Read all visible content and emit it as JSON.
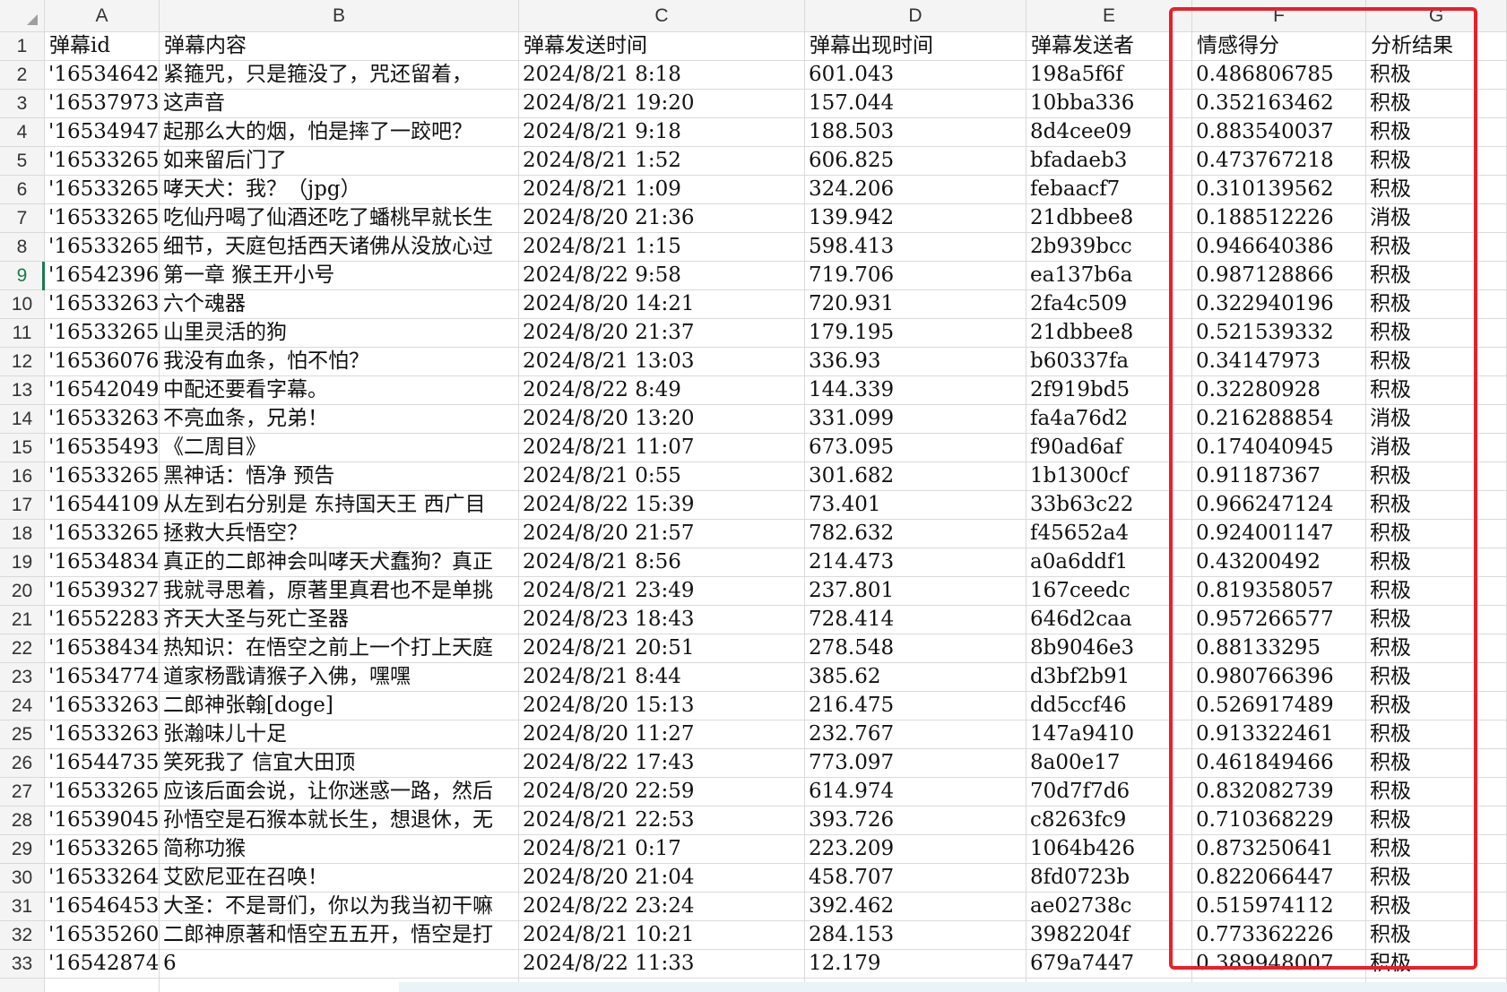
{
  "columns": [
    "A",
    "B",
    "C",
    "D",
    "E",
    "F",
    "G"
  ],
  "headers": [
    "弹幕id",
    "弹幕内容",
    "弹幕发送时间",
    "弹幕出现时间",
    "弹幕发送者",
    "情感得分",
    "分析结果"
  ],
  "active_row": 9,
  "highlight_color": "#e8202a",
  "rows": [
    [
      "'16534642",
      "紧箍咒，只是箍没了，咒还留着，",
      "2024/8/21  8:18",
      "601.043",
      "198a5f6f",
      "0.486806785",
      "积极"
    ],
    [
      "'16537973",
      "这声音",
      "2024/8/21  19:20",
      "157.044",
      "10bba336",
      "0.352163462",
      "积极"
    ],
    [
      "'16534947",
      "起那么大的烟，怕是摔了一跤吧？",
      "2024/8/21  9:18",
      "188.503",
      "8d4cee09",
      "0.883540037",
      "积极"
    ],
    [
      "'16533265",
      "如来留后门了",
      "2024/8/21  1:52",
      "606.825",
      "bfadaeb3",
      "0.473767218",
      "积极"
    ],
    [
      "'16533265",
      "哮天犬：我？（jpg）",
      "2024/8/21  1:09",
      "324.206",
      "febaacf7",
      "0.310139562",
      "积极"
    ],
    [
      "'16533265",
      "吃仙丹喝了仙酒还吃了蟠桃早就长生",
      "2024/8/20  21:36",
      "139.942",
      "21dbbee8",
      "0.188512226",
      "消极"
    ],
    [
      "'16533265",
      "细节，天庭包括西天诸佛从没放心过",
      "2024/8/21  1:15",
      "598.413",
      "2b939bcc",
      "0.946640386",
      "积极"
    ],
    [
      "'16542396",
      "第一章  猴王开小号",
      "2024/8/22  9:58",
      "719.706",
      "ea137b6a",
      "0.987128866",
      "积极"
    ],
    [
      "'16533263",
      "六个魂器",
      "2024/8/20  14:21",
      "720.931",
      "2fa4c509",
      "0.322940196",
      "积极"
    ],
    [
      "'16533265",
      "山里灵活的狗",
      "2024/8/20  21:37",
      "179.195",
      "21dbbee8",
      "0.521539332",
      "积极"
    ],
    [
      "'16536076",
      "我没有血条，怕不怕？",
      "2024/8/21  13:03",
      "336.93",
      "b60337fa",
      "0.34147973",
      "积极"
    ],
    [
      "'16542049",
      "中配还要看字幕。",
      "2024/8/22  8:49",
      "144.339",
      "2f919bd5",
      "0.32280928",
      "积极"
    ],
    [
      "'16533263",
      "不亮血条，兄弟！",
      "2024/8/20  13:20",
      "331.099",
      "fa4a76d2",
      "0.216288854",
      "消极"
    ],
    [
      "'16535493",
      "《二周目》",
      "2024/8/21  11:07",
      "673.095",
      "f90ad6af",
      "0.174040945",
      "消极"
    ],
    [
      "'16533265",
      "黑神话：悟净 预告",
      "2024/8/21  0:55",
      "301.682",
      "1b1300cf",
      "0.91187367",
      "积极"
    ],
    [
      "'16544109",
      "从左到右分别是 东持国天王 西广目",
      "2024/8/22  15:39",
      "73.401",
      "33b63c22",
      "0.966247124",
      "积极"
    ],
    [
      "'16533265",
      "拯救大兵悟空？",
      "2024/8/20  21:57",
      "782.632",
      "f45652a4",
      "0.924001147",
      "积极"
    ],
    [
      "'16534834",
      "真正的二郎神会叫哮天犬蠢狗？真正",
      "2024/8/21  8:56",
      "214.473",
      "a0a6ddf1",
      "0.43200492",
      "积极"
    ],
    [
      "'16539327",
      "我就寻思着，原著里真君也不是单挑",
      "2024/8/21  23:49",
      "237.801",
      "167ceedc",
      "0.819358057",
      "积极"
    ],
    [
      "'16552283",
      "齐天大圣与死亡圣器",
      "2024/8/23  18:43",
      "728.414",
      "646d2caa",
      "0.957266577",
      "积极"
    ],
    [
      "'16538434",
      "热知识：在悟空之前上一个打上天庭",
      "2024/8/21  20:51",
      "278.548",
      "8b9046e3",
      "0.88133295",
      "积极"
    ],
    [
      "'16534774",
      "道家杨戬请猴子入佛，嘿嘿",
      "2024/8/21  8:44",
      "385.62",
      "d3bf2b91",
      "0.980766396",
      "积极"
    ],
    [
      "'16533263",
      "二郎神张翰[doge]",
      "2024/8/20  15:13",
      "216.475",
      "dd5ccf46",
      "0.526917489",
      "积极"
    ],
    [
      "'16533263",
      "张瀚味儿十足",
      "2024/8/20  11:27",
      "232.767",
      "147a9410",
      "0.913322461",
      "积极"
    ],
    [
      "'16544735",
      "笑死我了 信宜大田顶",
      "2024/8/22  17:43",
      "773.097",
      "8a00e17",
      "0.461849466",
      "积极"
    ],
    [
      "'16533265",
      "应该后面会说，让你迷惑一路，然后",
      "2024/8/20  22:59",
      "614.974",
      "70d7f7d6",
      "0.832082739",
      "积极"
    ],
    [
      "'16539045",
      "孙悟空是石猴本就长生，想退休，无",
      "2024/8/21  22:53",
      "393.726",
      "c8263fc9",
      "0.710368229",
      "积极"
    ],
    [
      "'16533265",
      "简称功猴",
      "2024/8/21  0:17",
      "223.209",
      "1064b426",
      "0.873250641",
      "积极"
    ],
    [
      "'16533264",
      "艾欧尼亚在召唤！",
      "2024/8/20  21:04",
      "458.707",
      "8fd0723b",
      "0.822066447",
      "积极"
    ],
    [
      "'16546453",
      "大圣：不是哥们，你以为我当初干嘛",
      "2024/8/22  23:24",
      "392.462",
      "ae02738c",
      "0.515974112",
      "积极"
    ],
    [
      "'16535260",
      "二郎神原著和悟空五五开，悟空是打",
      "2024/8/21  10:21",
      "284.153",
      "3982204f",
      "0.773362226",
      "积极"
    ],
    [
      "'16542874",
      "6",
      "2024/8/22  11:33",
      "12.179",
      "679a7447",
      "0.389948007",
      "积极"
    ]
  ]
}
